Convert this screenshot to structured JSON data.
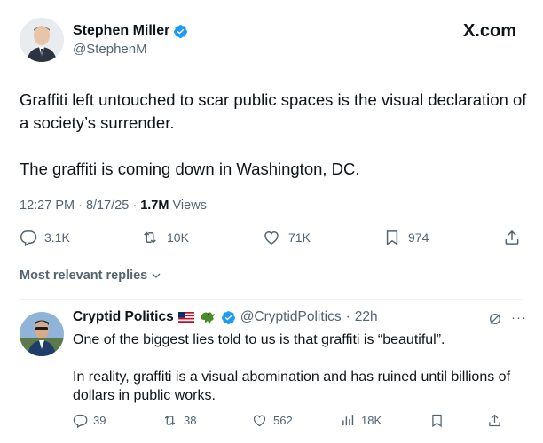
{
  "header": {
    "author_name": "Stephen Miller",
    "author_handle": "@StephenM",
    "site_logo": "X.com"
  },
  "tweet": {
    "paragraphs": [
      "Graffiti left untouched to scar public spaces is the visual declaration of a society’s surrender.",
      "The graffiti is coming down in Washington, DC."
    ],
    "time": "12:27 PM · 8/17/25 · ",
    "views_count": "1.7M",
    "views_label": " Views"
  },
  "actions": {
    "replies": "3.1K",
    "reposts": "10K",
    "likes": "71K",
    "bookmarks": "974"
  },
  "replies_sort": {
    "label": "Most relevant replies"
  },
  "reply": {
    "name": "Cryptid Politics",
    "handle": "@CryptidPolitics",
    "dot": "·",
    "time": "22h",
    "more": "···",
    "paragraphs": [
      "One of the biggest lies told to us is that graffiti is “beautiful”.",
      "In reality, graffiti is a visual abomination and has ruined until billions of dollars in public works."
    ],
    "actions": {
      "replies": "39",
      "reposts": "38",
      "likes": "562",
      "views": "18K"
    }
  },
  "colors": {
    "verified_blue": "#1d9bf0",
    "secondary_text": "#536471",
    "primary_text": "#0f1419"
  },
  "icons": [
    "verified-badge-icon",
    "reply-icon",
    "repost-icon",
    "like-icon",
    "bookmark-icon",
    "share-icon",
    "views-icon",
    "chevron-down-icon",
    "grok-icon",
    "more-icon",
    "us-flag-icon",
    "alligator-emoji-icon"
  ]
}
